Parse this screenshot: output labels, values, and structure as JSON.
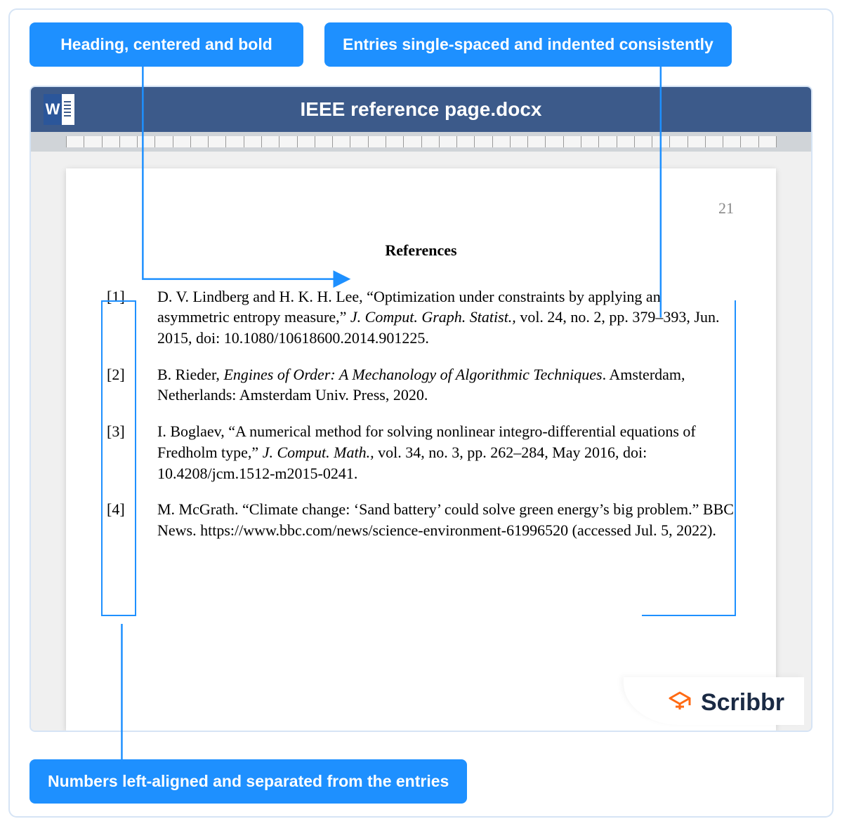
{
  "callouts": {
    "heading": "Heading, centered and bold",
    "entries": "Entries single-spaced and indented consistently",
    "numbers": "Numbers left-aligned and separated from the entries"
  },
  "window": {
    "title": "IEEE reference page.docx"
  },
  "page": {
    "number": "21",
    "heading": "References"
  },
  "references": [
    {
      "num": "[1]",
      "pre": "D. V. Lindberg and H. K. H. Lee, “Optimization under constraints by applying an asymmetric entropy measure,” ",
      "italic": "J. Comput. Graph. Statist.,",
      "post": " vol. 24, no. 2, pp. 379–393, Jun. 2015, doi: 10.1080/10618600.2014.901225."
    },
    {
      "num": "[2]",
      "pre": "B. Rieder, ",
      "italic": "Engines of Order: A Mechanology of Algorithmic Techniques",
      "post": ". Amsterdam, Netherlands: Amsterdam Univ. Press, 2020."
    },
    {
      "num": "[3]",
      "pre": "I. Boglaev, “A numerical method for solving nonlinear integro-differential equations of Fredholm type,” ",
      "italic": "J. Comput. Math.,",
      "post": " vol. 34, no. 3, pp. 262–284, May 2016, doi: 10.4208/jcm.1512-m2015-0241."
    },
    {
      "num": "[4]",
      "pre": "M. McGrath. “Climate change: ‘Sand battery’ could solve green energy’s big problem.” BBC News. https://www.bbc.com/news/science-environment-61996520 (accessed Jul. 5, 2022).",
      "italic": "",
      "post": ""
    }
  ],
  "brand": "Scribbr"
}
